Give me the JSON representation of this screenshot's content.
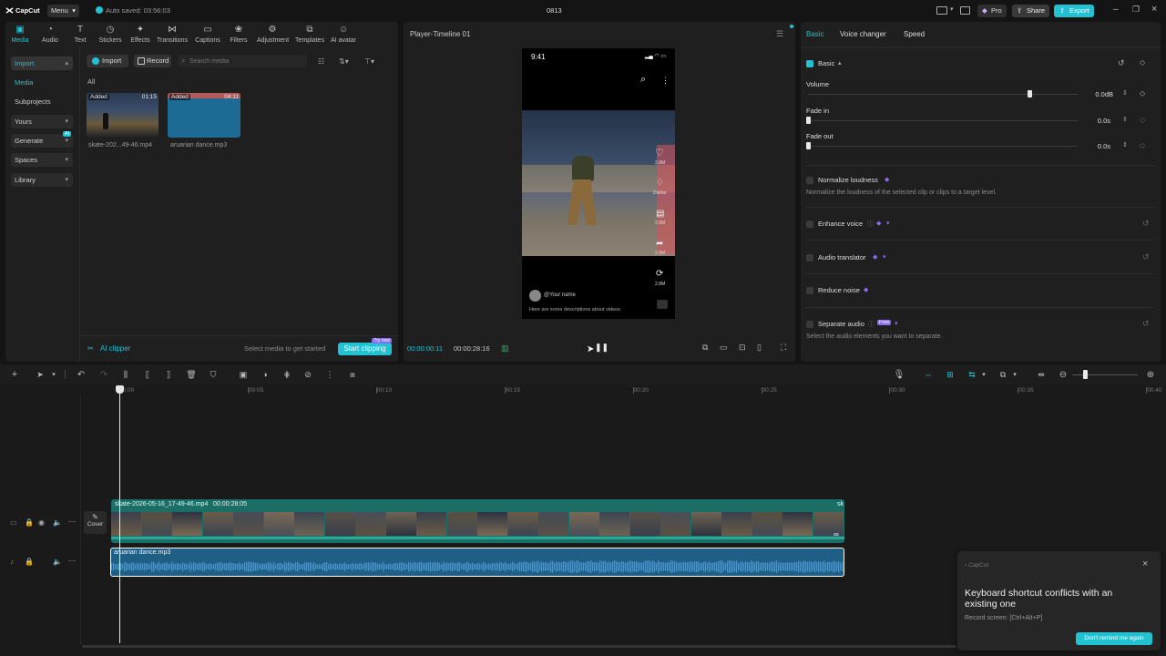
{
  "topbar": {
    "logo": "CapCut",
    "menu": "Menu",
    "autosave": "Auto saved: 03:56:03",
    "project_name": "0813",
    "pro": "Pro",
    "share": "Share",
    "export": "Export"
  },
  "toolbar": [
    {
      "label": "Media",
      "icon": "media-icon",
      "active": true
    },
    {
      "label": "Audio",
      "icon": "audio-icon"
    },
    {
      "label": "Text",
      "icon": "text-icon"
    },
    {
      "label": "Stickers",
      "icon": "stickers-icon"
    },
    {
      "label": "Effects",
      "icon": "effects-icon"
    },
    {
      "label": "Transitions",
      "icon": "transitions-icon"
    },
    {
      "label": "Captions",
      "icon": "captions-icon"
    },
    {
      "label": "Filters",
      "icon": "filters-icon"
    },
    {
      "label": "Adjustment",
      "icon": "adjustment-icon"
    },
    {
      "label": "Templates",
      "icon": "templates-icon"
    },
    {
      "label": "AI avatar",
      "icon": "ai-avatar-icon"
    }
  ],
  "sidebar": {
    "import": "Import",
    "media": "Media",
    "subprojects": "Subprojects",
    "yours": "Yours",
    "generate": "Generate",
    "ai_badge": "AI",
    "spaces": "Spaces",
    "library": "Library"
  },
  "media": {
    "import_btn": "Import",
    "record_btn": "Record",
    "search_placeholder": "Search media",
    "filter_all": "All",
    "items": [
      {
        "name": "skate-202...49-46.mp4",
        "badge": "Added",
        "duration": "01:15"
      },
      {
        "name": "aruarian dance.mp3",
        "badge": "Added",
        "duration": "04:11"
      }
    ],
    "ai_clipper": "AI clipper",
    "hint": "Select media to get started",
    "start_clipping": "Start clipping",
    "try_now": "Try now"
  },
  "player": {
    "title": "Player-Timeline 01",
    "current": "00:00:00:11",
    "total": "00:00:28:16",
    "phone": {
      "time": "9:41",
      "like_count": "2.8M",
      "dislike": "Dislike",
      "comment_count": "2.8M",
      "share_count": "2.8M",
      "remix_count": "2.8M",
      "username": "@Your name",
      "description": "Here are some descriptions about videos"
    }
  },
  "props": {
    "tabs": [
      "Basic",
      "Voice changer",
      "Speed"
    ],
    "basic": "Basic",
    "volume": {
      "label": "Volume",
      "value": "0.0dB",
      "level": 0.82
    },
    "fade_in": {
      "label": "Fade in",
      "value": "0.0s",
      "level": 0
    },
    "fade_out": {
      "label": "Fade out",
      "value": "0.0s",
      "level": 0
    },
    "normalize": "Normalize loudness",
    "normalize_desc": "Normalize the loudness of the selected clip or clips to a target level.",
    "enhance": "Enhance voice",
    "translator": "Audio translator",
    "reduce": "Reduce noise",
    "separate": "Separate audio",
    "free": "Free",
    "separate_desc": "Select the audio elements you want to separate."
  },
  "timeline": {
    "ticks": [
      "00:00",
      "00:05",
      "00:10",
      "00:15",
      "00:20",
      "00:25",
      "00:30",
      "00:35",
      "00:40"
    ],
    "video_clip": "skate-2026-05-16_17-49-46.mp4",
    "video_duration": "00:00:28:05",
    "video_tail": "sk",
    "cover": "Cover",
    "audio_clip": "aruarian dance.mp3"
  },
  "toast": {
    "app": "CapCut",
    "title": "Keyboard shortcut conflicts with an existing one",
    "sub": "Record screen: [Ctrl+Alt+P]",
    "btn": "Don't remind me again"
  },
  "colors": {
    "accent": "#22c2d3",
    "panel": "#1f1f1f",
    "bg": "#141414",
    "video_track": "#1b6e66",
    "audio_track": "#1f5f86",
    "premium": "#8b6cf0"
  }
}
